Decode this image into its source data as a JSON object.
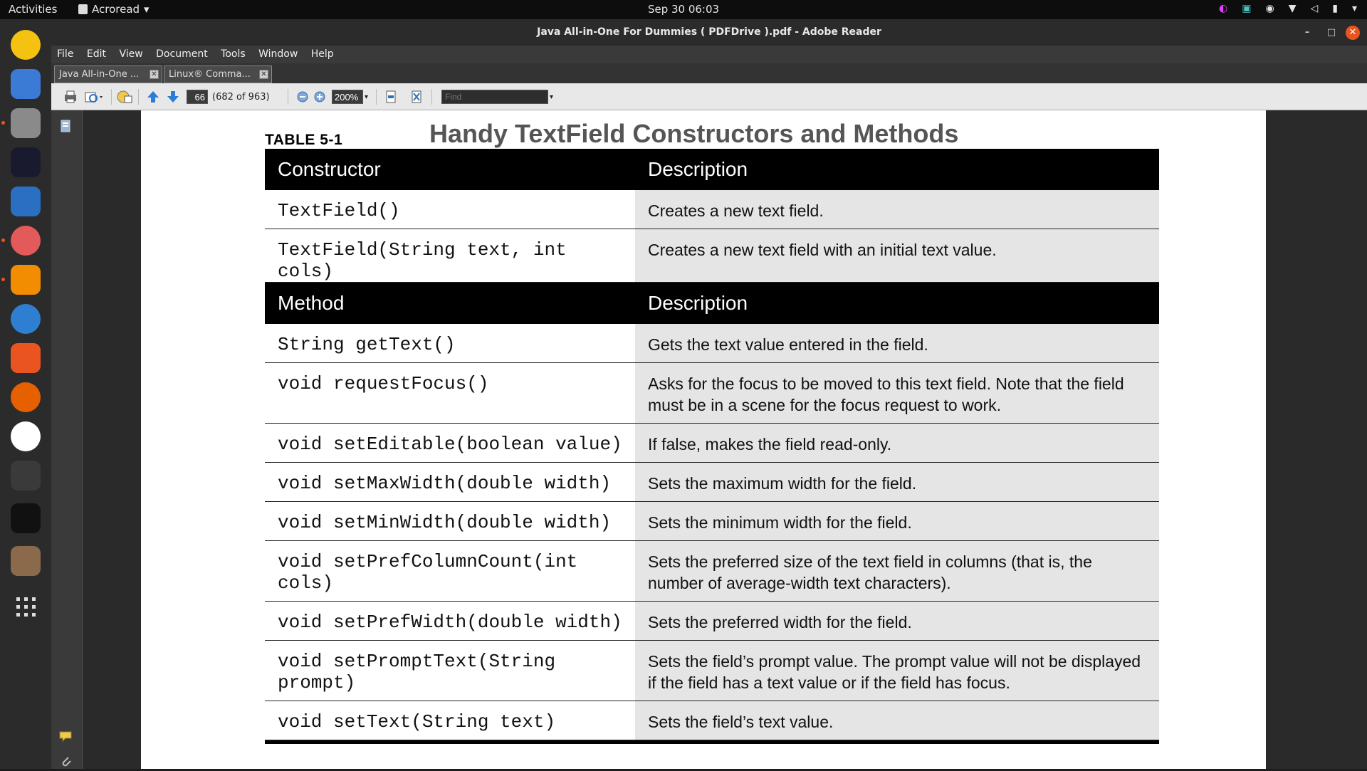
{
  "topbar": {
    "activities": "Activities",
    "app_name": "Acroread",
    "clock": "Sep 30  06:03"
  },
  "window": {
    "title": "Java All-in-One For Dummies ( PDFDrive ).pdf - Adobe Reader"
  },
  "menu": [
    "File",
    "Edit",
    "View",
    "Document",
    "Tools",
    "Window",
    "Help"
  ],
  "tabs": [
    {
      "label": "Java All-in-One ..."
    },
    {
      "label": "Linux® Comma..."
    }
  ],
  "toolbar": {
    "page_number": "66",
    "page_of": "(682 of 963)",
    "zoom": "200%",
    "find_placeholder": "Find"
  },
  "document": {
    "caption": "TABLE 5-1",
    "title": "Handy TextField Constructors and Methods",
    "constructor_header": [
      "Constructor",
      "Description"
    ],
    "constructors": [
      {
        "sig": "TextField()",
        "desc": "Creates a new text field."
      },
      {
        "sig": "TextField(String text, int cols)",
        "desc": "Creates a new text field with an initial text value."
      }
    ],
    "method_header": [
      "Method",
      "Description"
    ],
    "methods": [
      {
        "sig": "String getText()",
        "desc": "Gets the text value entered in the field."
      },
      {
        "sig": "void requestFocus()",
        "desc": "Asks for the focus to be moved to this text field. Note that the field must be in a scene for the focus request to work."
      },
      {
        "sig": "void setEditable(boolean value)",
        "desc": "If false, makes the field read-only."
      },
      {
        "sig": "void setMaxWidth(double width)",
        "desc": "Sets the maximum width for the field."
      },
      {
        "sig": "void setMinWidth(double width)",
        "desc": "Sets the minimum width for the field."
      },
      {
        "sig": "void setPrefColumnCount(int cols)",
        "desc": "Sets the preferred size of the text field in columns (that is, the number of average-width text characters)."
      },
      {
        "sig": "void setPrefWidth(double width)",
        "desc": "Sets the preferred width for the field."
      },
      {
        "sig": "void setPromptText(String prompt)",
        "desc": "Sets the field’s prompt value. The prompt value will not be displayed if the field has a text value or if the field has focus."
      },
      {
        "sig": "void setText(String text)",
        "desc": "Sets the field’s text value."
      }
    ]
  },
  "dock": [
    {
      "icon": "rhythmbox-icon",
      "color": "#f5c211"
    },
    {
      "icon": "thunderbird-icon",
      "color": "#3b7bd6"
    },
    {
      "icon": "files-icon",
      "color": "#8a8a8a"
    },
    {
      "icon": "intellij-icon",
      "color": "#1a1a2e"
    },
    {
      "icon": "writer-icon",
      "color": "#2a6fc2"
    },
    {
      "icon": "pie-app-icon",
      "color": "#e25a5a"
    },
    {
      "icon": "vlc-icon",
      "color": "#f28c00"
    },
    {
      "icon": "help-icon",
      "color": "#2e7fd1"
    },
    {
      "icon": "software-center-icon",
      "color": "#e95420"
    },
    {
      "icon": "firefox-icon",
      "color": "#e66000"
    },
    {
      "icon": "chrome-icon",
      "color": "#ffffff"
    },
    {
      "icon": "sublime-icon",
      "color": "#3a3a3a"
    },
    {
      "icon": "exness-icon",
      "color": "#111111"
    },
    {
      "icon": "book-icon",
      "color": "#8a6a4a"
    },
    {
      "icon": "app-grid-icon",
      "color": "#2b2b2b"
    }
  ]
}
